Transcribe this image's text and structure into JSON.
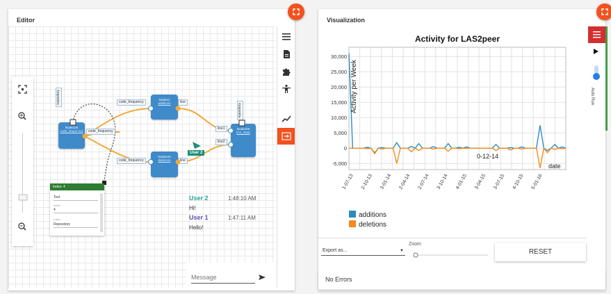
{
  "editor": {
    "title": "Editor",
    "nodes": [
      {
        "id": "node125",
        "title": "Node125",
        "subtitle": "code_freque ncy"
      },
      {
        "id": "node41",
        "title": "Node41",
        "subtitle": "additions"
      },
      {
        "id": "node223",
        "title": "Node223",
        "subtitle": "deletions"
      },
      {
        "id": "node229",
        "title": "Node229",
        "subtitle": "line_chart"
      }
    ],
    "edge_labels": [
      "code_frequency",
      "line",
      "code_frequency",
      "code_frequency",
      "line",
      "line1",
      "line2",
      "repository",
      "repository"
    ],
    "cursor_label": "User 2",
    "properties": {
      "header": "Index: 4",
      "type_value": "Text",
      "index_label": "Index",
      "index_value": "4",
      "label_label": "Label",
      "label_value": "Repository"
    },
    "chat": {
      "messages": [
        {
          "user": "User 2",
          "time": "1:48:10 AM",
          "text": "Hi!",
          "color": "#26a69a"
        },
        {
          "user": "User 1",
          "time": "1:47:11 AM",
          "text": "Hello!",
          "color": "#5c4fa6"
        }
      ],
      "input_placeholder": "Message"
    },
    "toolbar_icons": [
      "menu-icon",
      "file-icon",
      "puzzle-icon",
      "person-icon",
      "trending-icon",
      "exit-icon"
    ]
  },
  "visualization": {
    "title": "Visualization",
    "side_label": "Auto Run",
    "export_label": "Export as...",
    "zoom_label": "Zoom",
    "reset_label": "RESET",
    "status": "No Errors"
  },
  "chart_data": {
    "type": "line",
    "title": "Activity for LAS2peer",
    "ylabel": "Activity per Week",
    "xlabel": "date",
    "ylim": [
      -7000,
      33000
    ],
    "yticks": [
      -5000,
      0,
      5000,
      10000,
      15000,
      20000,
      25000,
      30000
    ],
    "ytick_labels": [
      "-5,000",
      "0",
      "5,000",
      "10,000",
      "15,000",
      "20,000",
      "25,000",
      "30,000"
    ],
    "xtick_labels": [
      "1-07-13",
      "2-10-13",
      "3-01-14",
      "2-04-14",
      "2-07-14",
      "3-10-14",
      "4-01-15",
      "3-04-15",
      "3-07-15",
      "4-10-15",
      "5-01-16"
    ],
    "hover_label": "0-12-14",
    "series": [
      {
        "name": "additions",
        "color": "#2e8bc0",
        "values": [
          31000,
          0,
          0,
          0,
          0,
          300,
          0,
          -1500,
          0,
          200,
          0,
          0,
          0,
          1800,
          0,
          0,
          0,
          600,
          0,
          1500,
          0,
          0,
          0,
          500,
          0,
          0,
          0,
          1500,
          0,
          0,
          300,
          0,
          400,
          0,
          0,
          0,
          0,
          0,
          0,
          0,
          1200,
          0,
          0,
          0,
          200,
          0,
          0,
          400,
          0,
          0,
          0,
          0,
          7500,
          0,
          -800,
          0,
          1200,
          0,
          400,
          0
        ]
      },
      {
        "name": "deletions",
        "color": "#f28c1c",
        "values": [
          0,
          0,
          0,
          0,
          0,
          -200,
          0,
          -1800,
          0,
          -300,
          0,
          0,
          0,
          -5000,
          0,
          0,
          0,
          -1200,
          0,
          -800,
          0,
          0,
          0,
          -300,
          0,
          0,
          0,
          -1000,
          0,
          0,
          -200,
          0,
          -100,
          0,
          0,
          0,
          0,
          0,
          0,
          0,
          -800,
          0,
          0,
          0,
          -600,
          0,
          0,
          -300,
          0,
          0,
          0,
          0,
          -6500,
          0,
          -1500,
          0,
          -400,
          0,
          -200,
          0
        ]
      }
    ]
  }
}
